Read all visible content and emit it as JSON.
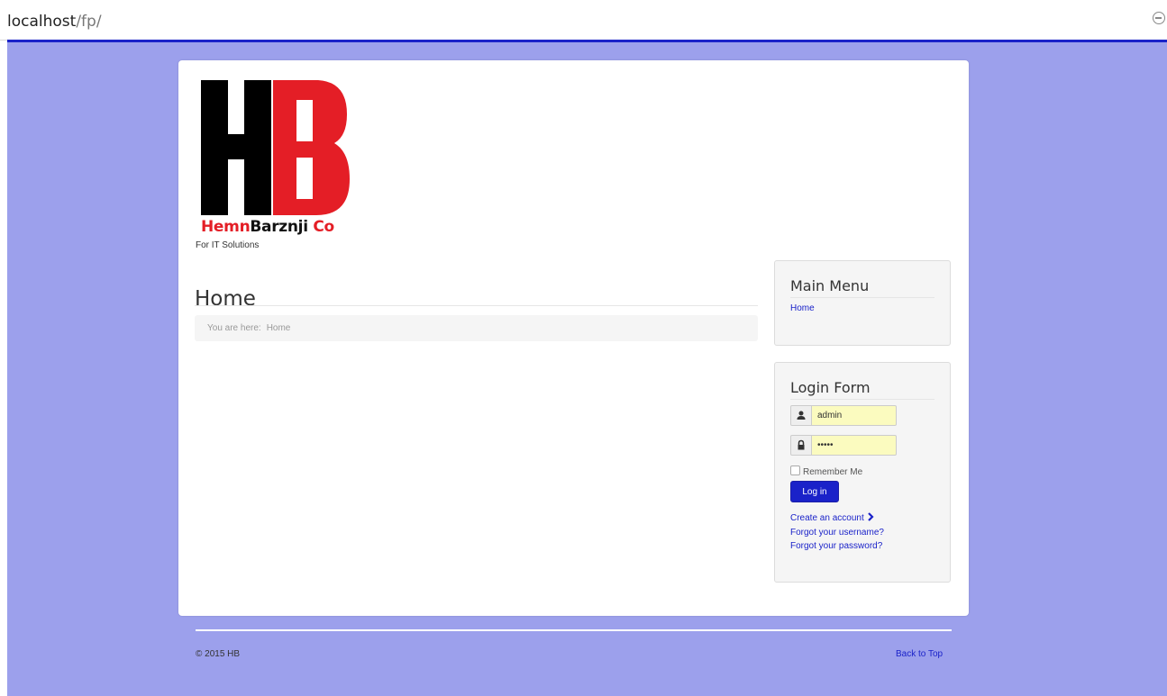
{
  "browser": {
    "url_host": "localhost",
    "url_path": "/fp/"
  },
  "logo": {
    "letters": "HB",
    "brand_part1": "Hemn",
    "brand_part2": "Barznji",
    "brand_part3": " Co",
    "tagline": "For IT Solutions"
  },
  "main": {
    "title": "Home",
    "breadcrumb_label": "You are here:",
    "breadcrumb_current": "Home"
  },
  "main_menu": {
    "title": "Main Menu",
    "items": [
      {
        "label": "Home"
      }
    ]
  },
  "login_form": {
    "title": "Login Form",
    "username_value": "admin",
    "password_value": "•••••",
    "remember_label": "Remember Me",
    "login_button": "Log in",
    "create_account": "Create an account",
    "forgot_username": "Forgot your username?",
    "forgot_password": "Forgot your password?"
  },
  "footer": {
    "copyright": "© 2015 HB",
    "back_to_top": "Back to Top"
  },
  "colors": {
    "page_background": "#9ca0ec",
    "accent": "#1a22c9",
    "logo_red": "#e41e26",
    "logo_black": "#000000"
  }
}
